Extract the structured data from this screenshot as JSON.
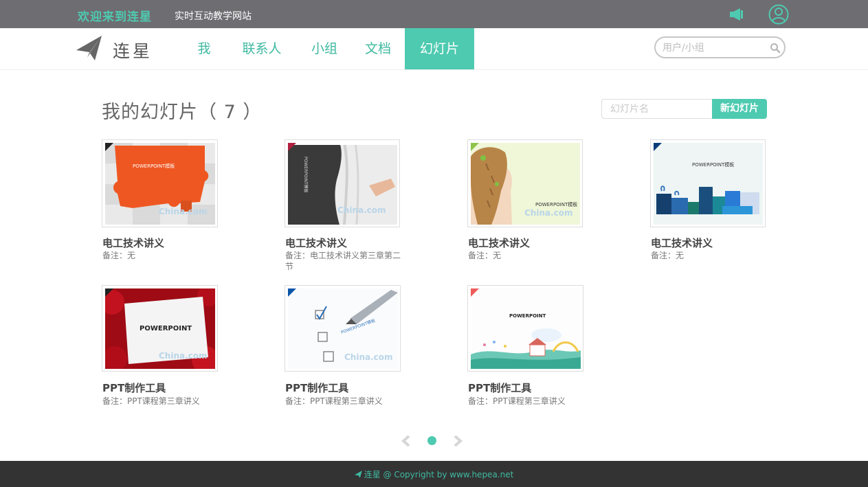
{
  "header": {
    "welcome": "欢迎来到连星",
    "subtitle": "实时互动教学网站",
    "icons": [
      "megaphone-icon",
      "user-icon"
    ]
  },
  "nav": {
    "logo_text": "连星",
    "items": [
      {
        "label": "我",
        "active": false
      },
      {
        "label": "联系人",
        "active": false
      },
      {
        "label": "小组",
        "active": false
      },
      {
        "label": "文档",
        "active": false
      },
      {
        "label": "幻灯片",
        "active": true
      }
    ],
    "search_placeholder": "用户/小组"
  },
  "main": {
    "title": "我的幻灯片（ 7 ）",
    "slide_name_placeholder": "幻灯片名",
    "new_slide_button": "新幻灯片",
    "slides": [
      {
        "title": "电工技术讲义",
        "note": "备注：无",
        "thumb_text": "POWERPOINT模板",
        "theme": "orange-puzzle"
      },
      {
        "title": "电工技术讲义",
        "note": "备注：电工技术讲义第三章第二节",
        "thumb_text": "POWERPOINT模板",
        "theme": "curtain"
      },
      {
        "title": "电工技术讲义",
        "note": "备注：无",
        "thumb_text": "POWERPOINT模板",
        "theme": "girl-braid"
      },
      {
        "title": "电工技术讲义",
        "note": "备注：无",
        "thumb_text": "POWERPOINT模板",
        "theme": "gift-boxes"
      },
      {
        "title": "PPT制作工具",
        "note": "备注：PPT课程第三章讲义",
        "thumb_text": "POWERPOINT",
        "theme": "red-roses"
      },
      {
        "title": "PPT制作工具",
        "note": "备注：PPT课程第三章讲义",
        "thumb_text": "POWERPOINT模板",
        "theme": "pen-checklist"
      },
      {
        "title": "PPT制作工具",
        "note": "备注：PPT课程第三章讲义",
        "thumb_text": "POWERPOINT",
        "theme": "cartoon-town"
      }
    ],
    "watermark": "China.com"
  },
  "pagination": {
    "current_page": 1,
    "total_pages": 1
  },
  "footer": {
    "text": "连星 @ Copyright by www.hepea.net"
  },
  "colors": {
    "accent": "#4ecab0",
    "topbar": "#6e6d72",
    "footer": "#333333"
  }
}
